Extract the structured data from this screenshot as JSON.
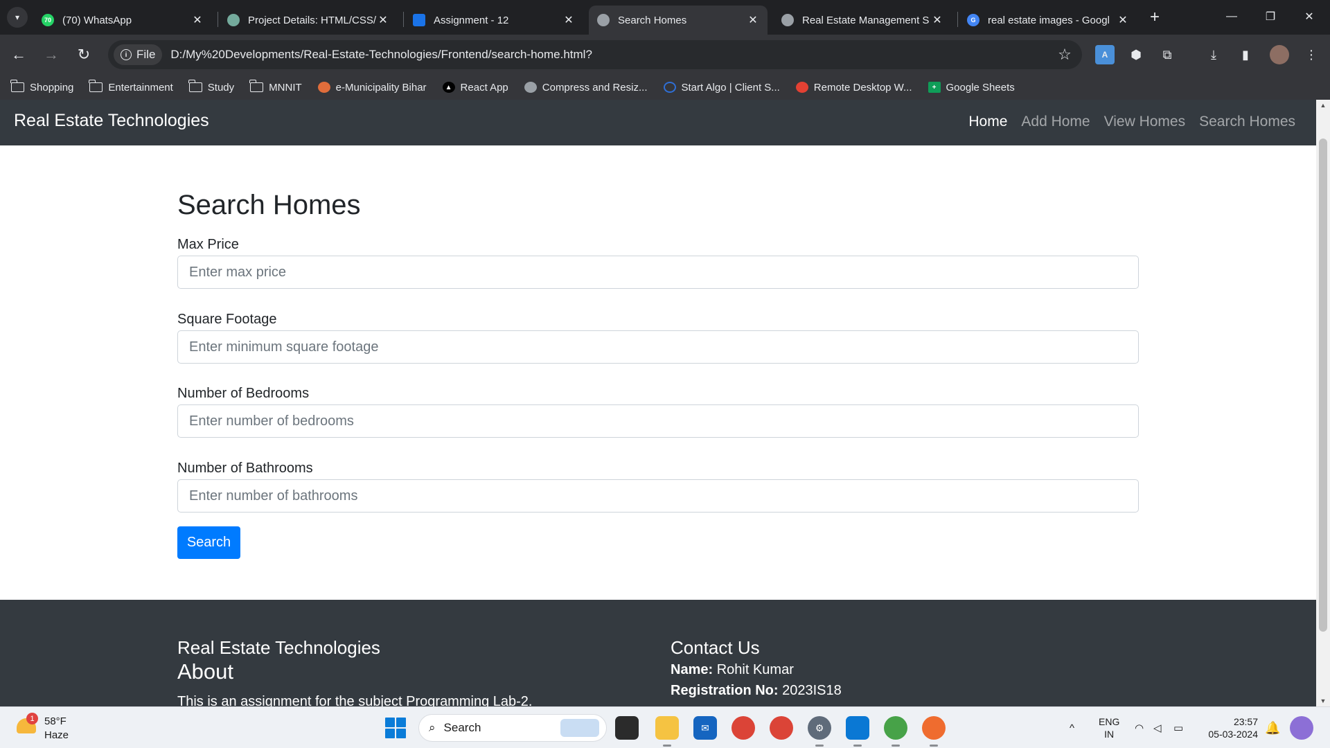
{
  "browser": {
    "tabs": [
      {
        "title": "(70) WhatsApp",
        "icon": "whatsapp-icon",
        "color": "#25d366",
        "active": false
      },
      {
        "title": "Project Details: HTML/CSS/",
        "icon": "chatgpt-icon",
        "color": "#74aa9c",
        "active": false
      },
      {
        "title": "Assignment - 12",
        "icon": "classroom-icon",
        "color": "#1a73e8",
        "active": false
      },
      {
        "title": "Search Homes",
        "icon": "globe-icon",
        "color": "#9aa0a6",
        "active": true
      },
      {
        "title": "Real Estate Management S",
        "icon": "globe-icon",
        "color": "#9aa0a6",
        "active": false
      },
      {
        "title": "real estate images - Googl",
        "icon": "google-icon",
        "color": "#4285f4",
        "active": false
      }
    ],
    "whatsapp_badge": "70",
    "omnibox": {
      "chip": "File",
      "url": "D:/My%20Developments/Real-Estate-Technologies/Frontend/search-home.html?"
    },
    "bookmarks": [
      {
        "label": "Shopping",
        "icon": "folder-icon"
      },
      {
        "label": "Entertainment",
        "icon": "folder-icon"
      },
      {
        "label": "Study",
        "icon": "folder-icon"
      },
      {
        "label": "MNNIT",
        "icon": "folder-icon"
      },
      {
        "label": "e-Municipality Bihar",
        "icon": "municipality-icon"
      },
      {
        "label": "React App",
        "icon": "react-app-icon"
      },
      {
        "label": "Compress and Resiz...",
        "icon": "globe-icon"
      },
      {
        "label": "Start Algo | Client S...",
        "icon": "startalgo-icon"
      },
      {
        "label": "Remote Desktop W...",
        "icon": "remote-desktop-icon"
      },
      {
        "label": "Google Sheets",
        "icon": "sheets-icon"
      }
    ]
  },
  "site": {
    "brand": "Real Estate Technologies",
    "nav": [
      "Home",
      "Add Home",
      "View Homes",
      "Search Homes"
    ],
    "active_nav": "Home"
  },
  "form": {
    "title": "Search Homes",
    "fields": [
      {
        "label": "Max Price",
        "placeholder": "Enter max price",
        "value": ""
      },
      {
        "label": "Square Footage",
        "placeholder": "Enter minimum square footage",
        "value": ""
      },
      {
        "label": "Number of Bedrooms",
        "placeholder": "Enter number of bedrooms",
        "value": ""
      },
      {
        "label": "Number of Bathrooms",
        "placeholder": "Enter number of bathrooms",
        "value": ""
      }
    ],
    "submit_label": "Search",
    "accent": "#007bff"
  },
  "footer": {
    "brand": "Real Estate Technologies",
    "about_heading": "About",
    "about_text": "This is an assignment for the subject Programming Lab-2.",
    "contact_heading": "Contact Us",
    "name_label": "Name:",
    "name_value": "Rohit Kumar",
    "reg_label": "Registration No:",
    "reg_value": "2023IS18"
  },
  "taskbar": {
    "weather_badge": "1",
    "temperature": "58°F",
    "condition": "Haze",
    "search_placeholder": "Search",
    "language": "ENG",
    "region": "IN",
    "time": "23:57",
    "date": "05-03-2024"
  }
}
